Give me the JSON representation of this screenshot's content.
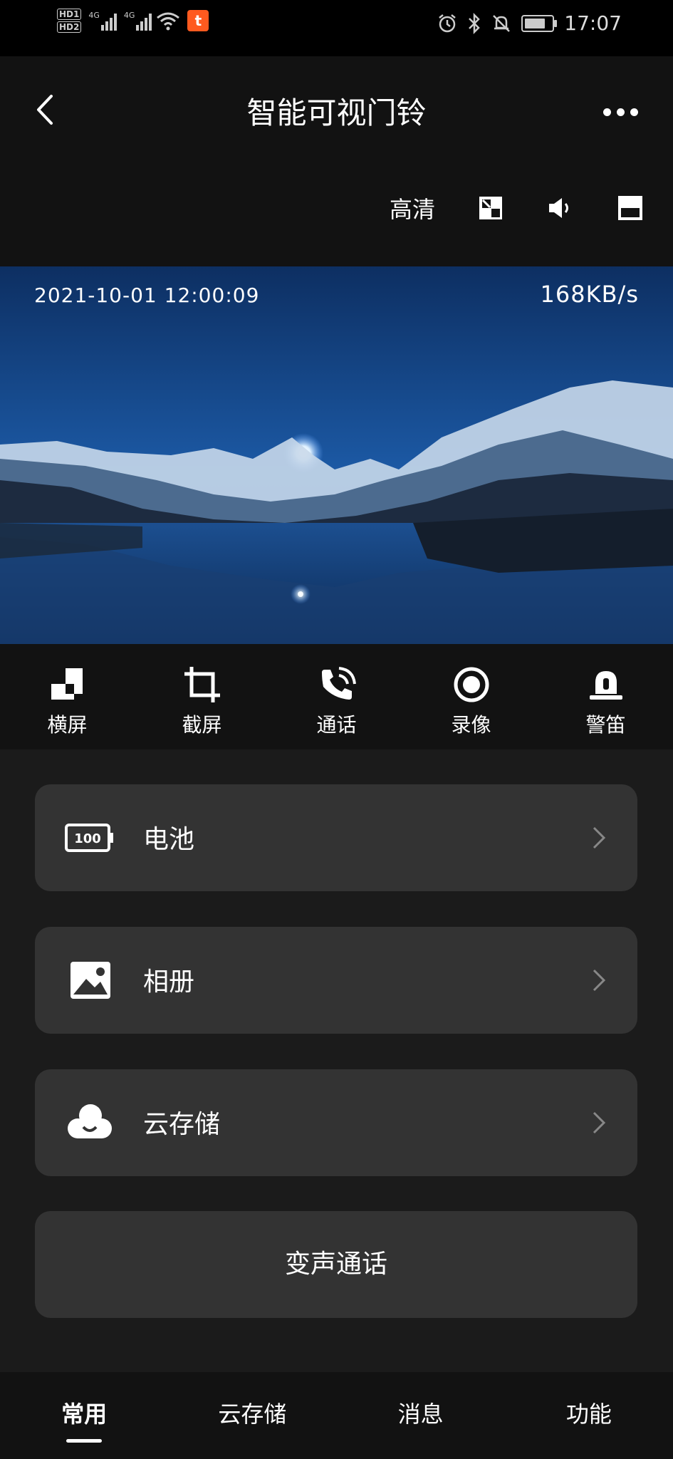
{
  "status_bar": {
    "hd1": "HD1",
    "hd2": "HD2",
    "net1": "4G",
    "net2": "4G",
    "app_badge": "t",
    "time": "17:07"
  },
  "header": {
    "title": "智能可视门铃",
    "quality_label": "高清"
  },
  "video": {
    "timestamp": "2021-10-01  12:00:09",
    "bitrate": "168KB/s"
  },
  "actions": [
    {
      "label": "横屏",
      "icon": "landscape-icon"
    },
    {
      "label": "截屏",
      "icon": "crop-icon"
    },
    {
      "label": "通话",
      "icon": "phone-icon"
    },
    {
      "label": "录像",
      "icon": "record-icon"
    },
    {
      "label": "警笛",
      "icon": "siren-icon"
    }
  ],
  "cards": [
    {
      "label": "电池",
      "icon": "battery-icon",
      "icon_text": "100"
    },
    {
      "label": "相册",
      "icon": "gallery-icon"
    },
    {
      "label": "云存储",
      "icon": "cloud-icon"
    }
  ],
  "voice_button": "变声通话",
  "tabs": [
    {
      "label": "常用",
      "active": true
    },
    {
      "label": "云存储",
      "active": false
    },
    {
      "label": "消息",
      "active": false
    },
    {
      "label": "功能",
      "active": false
    }
  ]
}
